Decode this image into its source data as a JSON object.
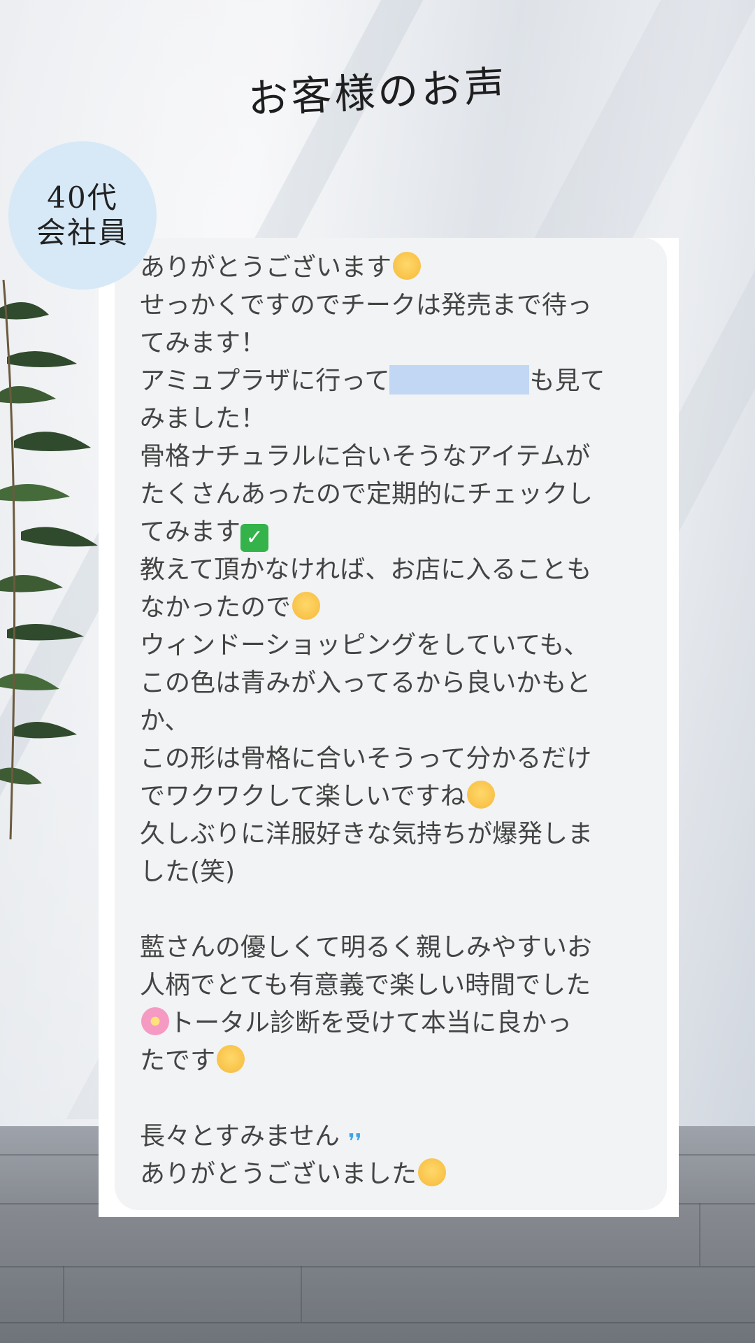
{
  "heading": "お客様のお声",
  "badge": {
    "age": "40代",
    "occupation": "会社員"
  },
  "message": {
    "lines": [
      {
        "text": "ありがとうございます",
        "emoji": "praying-face"
      },
      {
        "text": "せっかくですのでチークは発売まで待っ"
      },
      {
        "text": "てみます！"
      },
      {
        "text_before": "アミュプラザに行って",
        "redacted": true,
        "text_after": "も見て"
      },
      {
        "text": "みました！"
      },
      {
        "text": "骨格ナチュラルに合いそうなアイテムが"
      },
      {
        "text": "たくさんあったので定期的にチェックし"
      },
      {
        "text": "てみます",
        "emoji": "check-mark"
      },
      {
        "text": "教えて頂かなければ、お店に入ることも"
      },
      {
        "text": "なかったので",
        "emoji": "celebrating-face"
      },
      {
        "text": "ウィンドーショッピングをしていても、"
      },
      {
        "text": "この色は青みが入ってるから良いかもと"
      },
      {
        "text": "か、"
      },
      {
        "text": "この形は骨格に合いそうって分かるだけ"
      },
      {
        "text": "でワクワクして楽しいですね",
        "emoji": "hearts-face"
      },
      {
        "text": "久しぶりに洋服好きな気持ちが爆発しま"
      },
      {
        "text": "した(笑)"
      },
      {
        "blank": true
      },
      {
        "text": "藍さんの優しくて明るく親しみやすいお"
      },
      {
        "text": "人柄でとても有意義で楽しい時間でした"
      },
      {
        "text": "トータル診断を受けて本当に良かっ",
        "emoji_before": "cherry-blossom"
      },
      {
        "text": "たです",
        "emoji": "crying-happy-face"
      },
      {
        "blank": true
      },
      {
        "text": "長々とすみません",
        "emoji": "sweat-drops"
      },
      {
        "text": "ありがとうございました",
        "emoji": "bowing-face"
      }
    ]
  },
  "colors": {
    "badge_bg": "#d7e9f7",
    "bubble_bg": "#f1f3f5",
    "text": "#444444",
    "redaction": "#c2d7f4"
  }
}
